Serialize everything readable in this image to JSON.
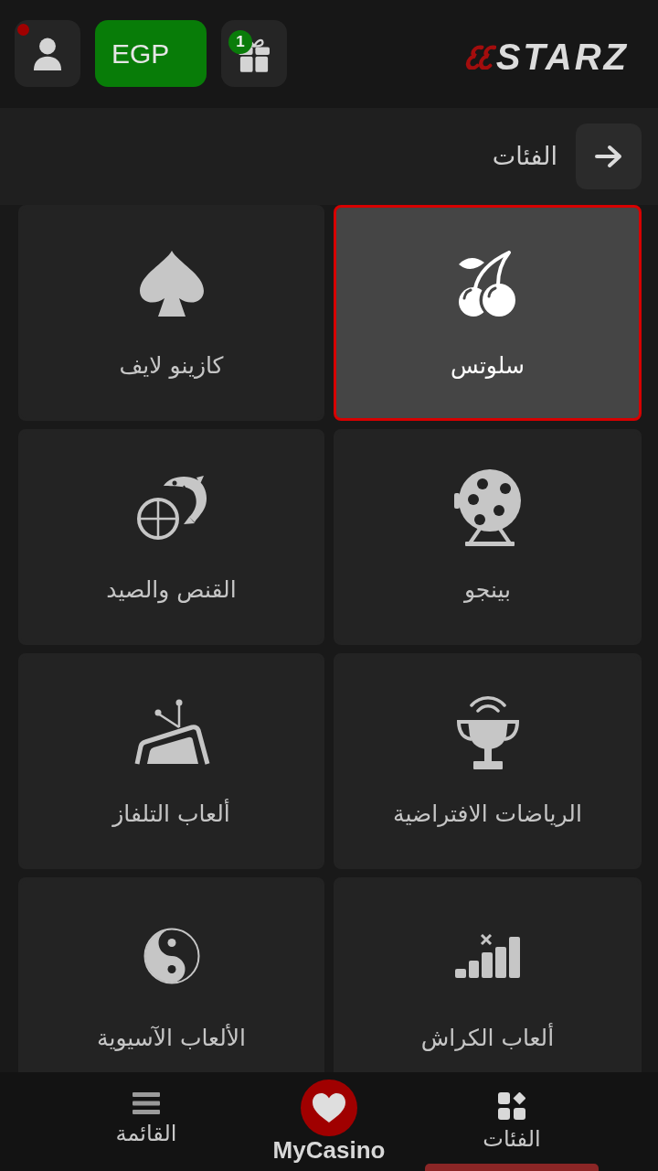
{
  "header": {
    "profile": {
      "notification": true
    },
    "currency": "EGP",
    "gift": {
      "count": "1"
    },
    "logo": "STARZ"
  },
  "page": {
    "title": "الفئات"
  },
  "categories": [
    {
      "label": "سلوتس",
      "selected": true
    },
    {
      "label": "كازينو لايف",
      "selected": false
    },
    {
      "label": "بينجو",
      "selected": false
    },
    {
      "label": "القنص والصيد",
      "selected": false
    },
    {
      "label": "الرياضات الافتراضية",
      "selected": false
    },
    {
      "label": "ألعاب التلفاز",
      "selected": false
    },
    {
      "label": "ألعاب الكراش",
      "selected": false
    },
    {
      "label": "الألعاب الآسيوية",
      "selected": false
    }
  ],
  "nav": [
    {
      "label": "الفئات",
      "kind": "tab",
      "selected": true
    },
    {
      "label": "MyCasino",
      "kind": "featured",
      "selected": false
    },
    {
      "label": "القائمة",
      "kind": "tab",
      "selected": false
    }
  ]
}
